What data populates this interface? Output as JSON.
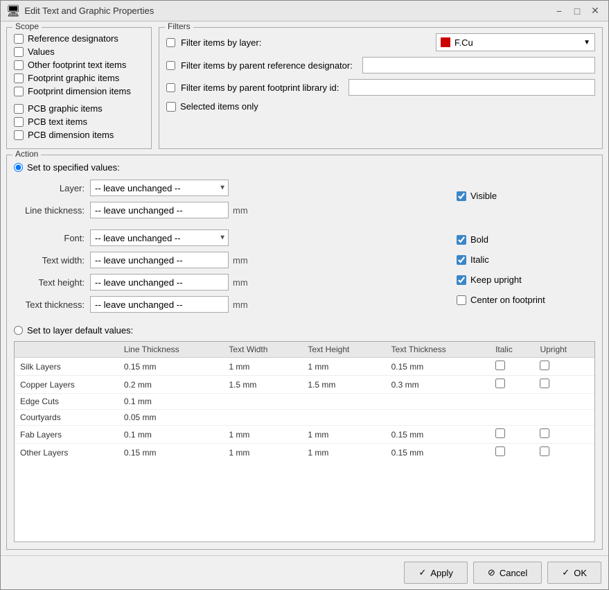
{
  "window": {
    "title": "Edit Text and Graphic Properties",
    "icon": "🖥"
  },
  "titlebar": {
    "minimize_label": "−",
    "maximize_label": "□",
    "close_label": "✕"
  },
  "scope": {
    "label": "Scope",
    "items": [
      {
        "id": "ref-designators",
        "label": "Reference designators",
        "checked": false
      },
      {
        "id": "values",
        "label": "Values",
        "checked": false
      },
      {
        "id": "other-fp-text",
        "label": "Other footprint text items",
        "checked": false
      },
      {
        "id": "fp-graphic",
        "label": "Footprint graphic items",
        "checked": false
      },
      {
        "id": "fp-dimension",
        "label": "Footprint dimension items",
        "checked": false
      },
      {
        "id": "pcb-graphic",
        "label": "PCB graphic items",
        "checked": false
      },
      {
        "id": "pcb-text",
        "label": "PCB text items",
        "checked": false
      },
      {
        "id": "pcb-dimension",
        "label": "PCB dimension items",
        "checked": false
      }
    ]
  },
  "filters": {
    "label": "Filters",
    "filter_by_layer_label": "Filter items by layer:",
    "filter_by_layer_checked": false,
    "layer_value": "F.Cu",
    "filter_by_ref_label": "Filter items by parent reference designator:",
    "filter_by_ref_checked": false,
    "filter_by_ref_value": "",
    "filter_by_lib_label": "Filter items by parent footprint library id:",
    "filter_by_lib_checked": false,
    "filter_by_lib_value": "",
    "selected_only_label": "Selected items only",
    "selected_only_checked": false
  },
  "action": {
    "label": "Action",
    "set_specified_label": "Set to specified values:",
    "set_specified_checked": true,
    "layer_label": "Layer:",
    "layer_value": "-- leave unchanged --",
    "visible_label": "Visible",
    "visible_checked": true,
    "line_thickness_label": "Line thickness:",
    "line_thickness_value": "-- leave unchanged --",
    "line_thickness_unit": "mm",
    "font_label": "Font:",
    "font_value": "-- leave unchanged --",
    "bold_label": "Bold",
    "bold_checked": true,
    "text_width_label": "Text width:",
    "text_width_value": "-- leave unchanged --",
    "text_width_unit": "mm",
    "italic_label": "Italic",
    "italic_checked": true,
    "text_height_label": "Text height:",
    "text_height_value": "-- leave unchanged --",
    "text_height_unit": "mm",
    "keep_upright_label": "Keep upright",
    "keep_upright_checked": true,
    "text_thickness_label": "Text thickness:",
    "text_thickness_value": "-- leave unchanged --",
    "text_thickness_unit": "mm",
    "center_on_fp_label": "Center on footprint",
    "center_on_fp_checked": false,
    "set_layer_default_label": "Set to layer default values:",
    "set_layer_default_checked": false
  },
  "table": {
    "columns": [
      "",
      "Line Thickness",
      "Text Width",
      "Text Height",
      "Text Thickness",
      "Italic",
      "Upright"
    ],
    "rows": [
      {
        "name": "Silk Layers",
        "line_thickness": "0.15 mm",
        "text_width": "1 mm",
        "text_height": "1 mm",
        "text_thickness": "0.15 mm",
        "italic": false,
        "upright": false
      },
      {
        "name": "Copper Layers",
        "line_thickness": "0.2 mm",
        "text_width": "1.5 mm",
        "text_height": "1.5 mm",
        "text_thickness": "0.3 mm",
        "italic": false,
        "upright": false
      },
      {
        "name": "Edge Cuts",
        "line_thickness": "0.1 mm",
        "text_width": "",
        "text_height": "",
        "text_thickness": "",
        "italic": null,
        "upright": null
      },
      {
        "name": "Courtyards",
        "line_thickness": "0.05 mm",
        "text_width": "",
        "text_height": "",
        "text_thickness": "",
        "italic": null,
        "upright": null
      },
      {
        "name": "Fab Layers",
        "line_thickness": "0.1 mm",
        "text_width": "1 mm",
        "text_height": "1 mm",
        "text_thickness": "0.15 mm",
        "italic": false,
        "upright": false
      },
      {
        "name": "Other Layers",
        "line_thickness": "0.15 mm",
        "text_width": "1 mm",
        "text_height": "1 mm",
        "text_thickness": "0.15 mm",
        "italic": false,
        "upright": false
      }
    ]
  },
  "footer": {
    "apply_label": "Apply",
    "cancel_label": "Cancel",
    "ok_label": "OK"
  }
}
